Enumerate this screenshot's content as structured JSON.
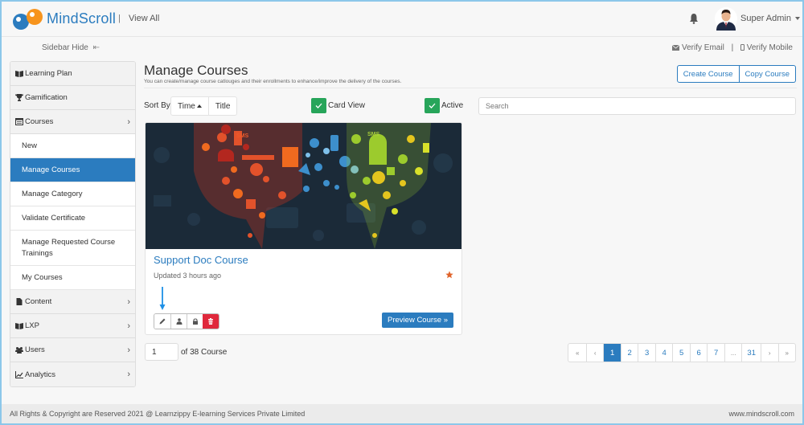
{
  "header": {
    "brand": "MindScroll",
    "separator": "|",
    "view_all": "View All",
    "user_name": "Super Admin",
    "icons": {
      "logo": "mindscroll-logo",
      "notifications": "bell-icon",
      "avatar": "user-avatar",
      "dropdown": "caret-down-icon"
    }
  },
  "subbar": {
    "sidebar_hide": "Sidebar Hide",
    "sidebar_hide_icon": "⇤",
    "verify_email": "Verify Email",
    "verify_separator": "|",
    "verify_mobile": "Verify Mobile"
  },
  "sidebar": {
    "items": [
      {
        "label": "Learning Plan",
        "icon": "book-open-icon",
        "has_chevron": false
      },
      {
        "label": "Gamification",
        "icon": "trophy-icon",
        "has_chevron": false
      },
      {
        "label": "Courses",
        "icon": "list-alt-icon",
        "has_chevron": true,
        "expanded": true,
        "children": [
          {
            "label": "New"
          },
          {
            "label": "Manage Courses",
            "active": true
          },
          {
            "label": "Manage Category"
          },
          {
            "label": "Validate Certificate"
          },
          {
            "label": "Manage Requested Course Trainings"
          },
          {
            "label": "My Courses"
          }
        ]
      },
      {
        "label": "Content",
        "icon": "file-icon",
        "has_chevron": true
      },
      {
        "label": "LXP",
        "icon": "book-open-icon",
        "has_chevron": true
      },
      {
        "label": "Users",
        "icon": "users-icon",
        "has_chevron": true
      },
      {
        "label": "Analytics",
        "icon": "line-chart-icon",
        "has_chevron": true
      }
    ],
    "chevron": "›"
  },
  "main": {
    "title": "Manage Courses",
    "subtitle": "You can create/manage course catlouges and their enrollments to enhance/improve the delivery of the courses.",
    "create_course": "Create Course",
    "copy_course": "Copy Course",
    "sort_by_label": "Sort By",
    "sort_options": [
      "Time",
      "Title"
    ],
    "sort_active": "Time",
    "card_view_label": "Card View",
    "card_view_checked": true,
    "active_label": "Active",
    "active_checked": true,
    "search_placeholder": "Search",
    "search_value": ""
  },
  "courses": [
    {
      "title": "Support Doc Course",
      "updated": "Updated 3 hours ago",
      "featured": true,
      "preview_label": "Preview Course »",
      "actions": [
        "edit-icon",
        "user-icon",
        "lock-icon",
        "trash-icon"
      ]
    }
  ],
  "pagination": {
    "current_page_input": "1",
    "of_text": "of 38 Course",
    "pages": [
      "«",
      "‹",
      "1",
      "2",
      "3",
      "4",
      "5",
      "6",
      "7",
      "...",
      "31",
      "›",
      "»"
    ],
    "active_page": "1"
  },
  "footer": {
    "copyright": "All Rights & Copyright are Reserved 2021 @ Learnzippy E-learning Services Private Limited",
    "website": "www.mindscroll.com"
  },
  "colors": {
    "primary": "#2b7cbf",
    "success": "#27a55a",
    "danger": "#e0283c",
    "star": "#e0632a",
    "logo_orange": "#f7941d",
    "frame": "#8cc7ea"
  }
}
